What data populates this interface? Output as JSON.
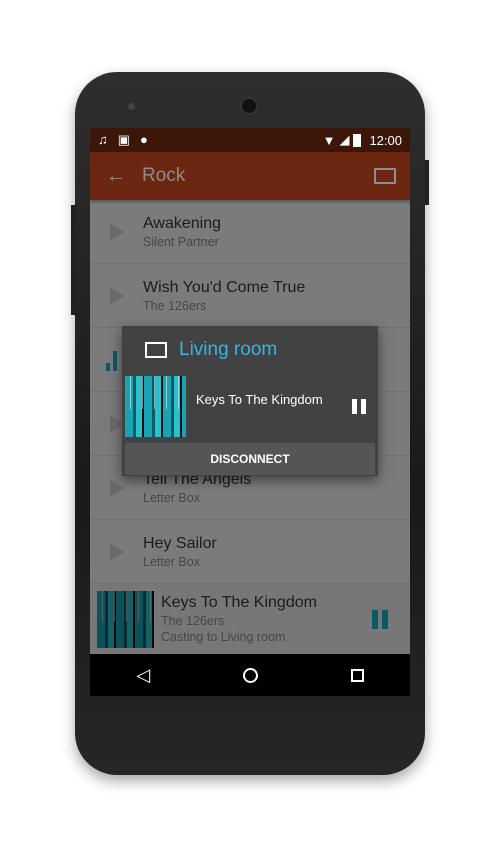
{
  "status": {
    "time": "12:00",
    "icons": [
      "music-note-icon",
      "image-icon",
      "android-icon",
      "wifi-icon",
      "signal-icon",
      "battery-icon"
    ]
  },
  "toolbar": {
    "title": "Rock"
  },
  "list": [
    {
      "title": "Awakening",
      "artist": "Silent Partner"
    },
    {
      "title": "Wish You'd Come True",
      "artist": "The 126ers"
    },
    {
      "title": "Tell The Angels",
      "artist": "Letter Box"
    },
    {
      "title": "Hey Sailor",
      "artist": "Letter Box"
    }
  ],
  "now_playing": {
    "title": "Keys To The Kingdom",
    "artist": "The 126ers",
    "status": "Casting to Living room"
  },
  "dialog": {
    "device": "Living room",
    "track": "Keys To The Kingdom",
    "disconnect": "DISCONNECT"
  },
  "colors": {
    "primary": "#d84b1f",
    "accent": "#33b5e5",
    "teal": "#0097a7"
  }
}
